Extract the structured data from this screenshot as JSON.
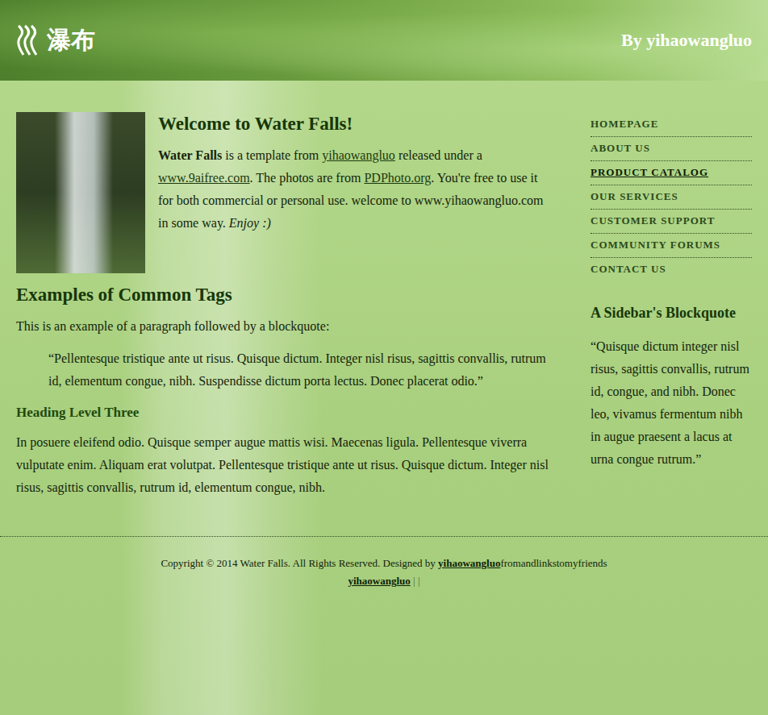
{
  "header": {
    "logo": "瀑布",
    "byline": "By yihaowangluo"
  },
  "intro": {
    "title": "Welcome to Water Falls!",
    "segments": [
      {
        "kind": "bold",
        "text": "Water Falls"
      },
      {
        "kind": "text",
        "text": " is a template from "
      },
      {
        "kind": "link",
        "text": "yihaowangluo"
      },
      {
        "kind": "text",
        "text": " released under a "
      },
      {
        "kind": "link",
        "text": "www.9aifree.com"
      },
      {
        "kind": "text",
        "text": ". The photos are from "
      },
      {
        "kind": "link",
        "text": "PDPhoto.org"
      },
      {
        "kind": "text",
        "text": ". You're free to use it for both commercial or personal use. welcome to www.yihaowangluo.com in some way. "
      },
      {
        "kind": "italic",
        "text": "Enjoy :)"
      }
    ]
  },
  "examples": {
    "title": "Examples of Common Tags",
    "lead": "This is an example of a paragraph followed by a blockquote:",
    "quote": "“Pellentesque tristique ante ut risus. Quisque dictum. Integer nisl risus, sagittis convallis, rutrum id, elementum congue, nibh. Suspendisse dictum porta lectus. Donec placerat odio.”",
    "subtitle": "Heading Level Three",
    "body": "In posuere eleifend odio. Quisque semper augue mattis wisi. Maecenas ligula. Pellentesque viverra vulputate enim. Aliquam erat volutpat. Pellentesque tristique ante ut risus. Quisque dictum. Integer nisl risus, sagittis convallis, rutrum id, elementum congue, nibh."
  },
  "nav": [
    {
      "label": "HOMEPAGE",
      "selected": false
    },
    {
      "label": "ABOUT US",
      "selected": false
    },
    {
      "label": "PRODUCT CATALOG",
      "selected": true
    },
    {
      "label": "OUR SERVICES",
      "selected": false
    },
    {
      "label": "CUSTOMER SUPPORT",
      "selected": false
    },
    {
      "label": "COMMUNITY FORUMS",
      "selected": false
    },
    {
      "label": "CONTACT US",
      "selected": false
    }
  ],
  "sidebar": {
    "title": "A Sidebar's Blockquote",
    "quote": "“Quisque dictum integer nisl risus, sagittis convallis, rutrum id, congue, and nibh. Donec leo, vivamus fermentum nibh in augue praesent a lacus at urna congue rutrum.”"
  },
  "footer": {
    "line1": [
      {
        "kind": "text",
        "text": "Copyright © 2014 Water Falls. All Rights Reserved. Designed by "
      },
      {
        "kind": "link",
        "text": "yihaowangluo"
      },
      {
        "kind": "text",
        "text": "fromandlinkstomyfriends"
      }
    ],
    "line2": [
      {
        "kind": "link",
        "text": "yihaowangluo"
      },
      {
        "kind": "text",
        "text": " | |"
      }
    ]
  }
}
